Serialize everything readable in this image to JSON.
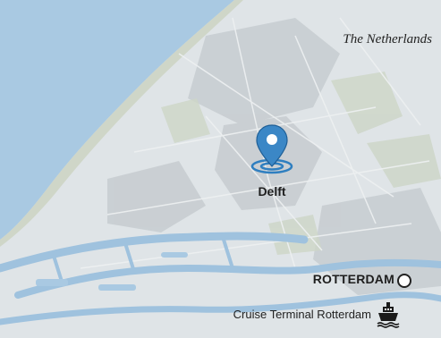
{
  "map": {
    "country_label": "The Netherlands",
    "accent_color": "#2f7fc0",
    "places": {
      "delft": {
        "label": "Delft",
        "marker": "location-pin-icon"
      },
      "rotterdam": {
        "label": "ROTTERDAM",
        "marker": "circle-marker-icon"
      },
      "cruise_terminal": {
        "label": "Cruise Terminal Rotterdam",
        "marker": "ship-icon"
      }
    }
  }
}
